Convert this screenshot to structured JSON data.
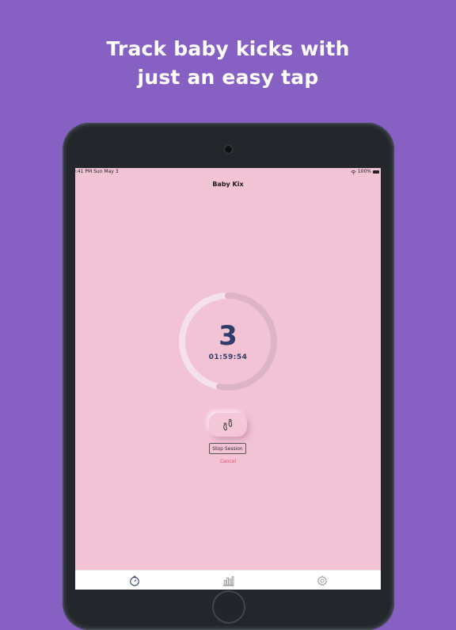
{
  "headline": {
    "line1": "Track baby kicks with",
    "line2": "just an easy tap"
  },
  "status_bar": {
    "time_date": "9:41 PM   Sun May 3",
    "battery_percent": "100%",
    "icons": [
      "wifi-icon",
      "battery-icon"
    ]
  },
  "nav": {
    "title": "Baby Kix"
  },
  "session": {
    "kick_count": "3",
    "elapsed": "01:59:54",
    "progress_fraction": 0.53
  },
  "actions": {
    "kick_icon": "baby-feet-icon",
    "stop_label": "Stop Session",
    "cancel_label": "Cancel"
  },
  "tabs": [
    {
      "icon": "timer-icon",
      "active": true
    },
    {
      "icon": "bar-chart-icon",
      "active": false
    },
    {
      "icon": "gear-icon",
      "active": false
    }
  ],
  "colors": {
    "background": "#8660c2",
    "screen": "#f2c2d5",
    "ring_track": "#f5e1ea",
    "ring_progress": "#ddb3c6",
    "count_text": "#2e3d6b",
    "cancel_text": "#e8506b"
  }
}
